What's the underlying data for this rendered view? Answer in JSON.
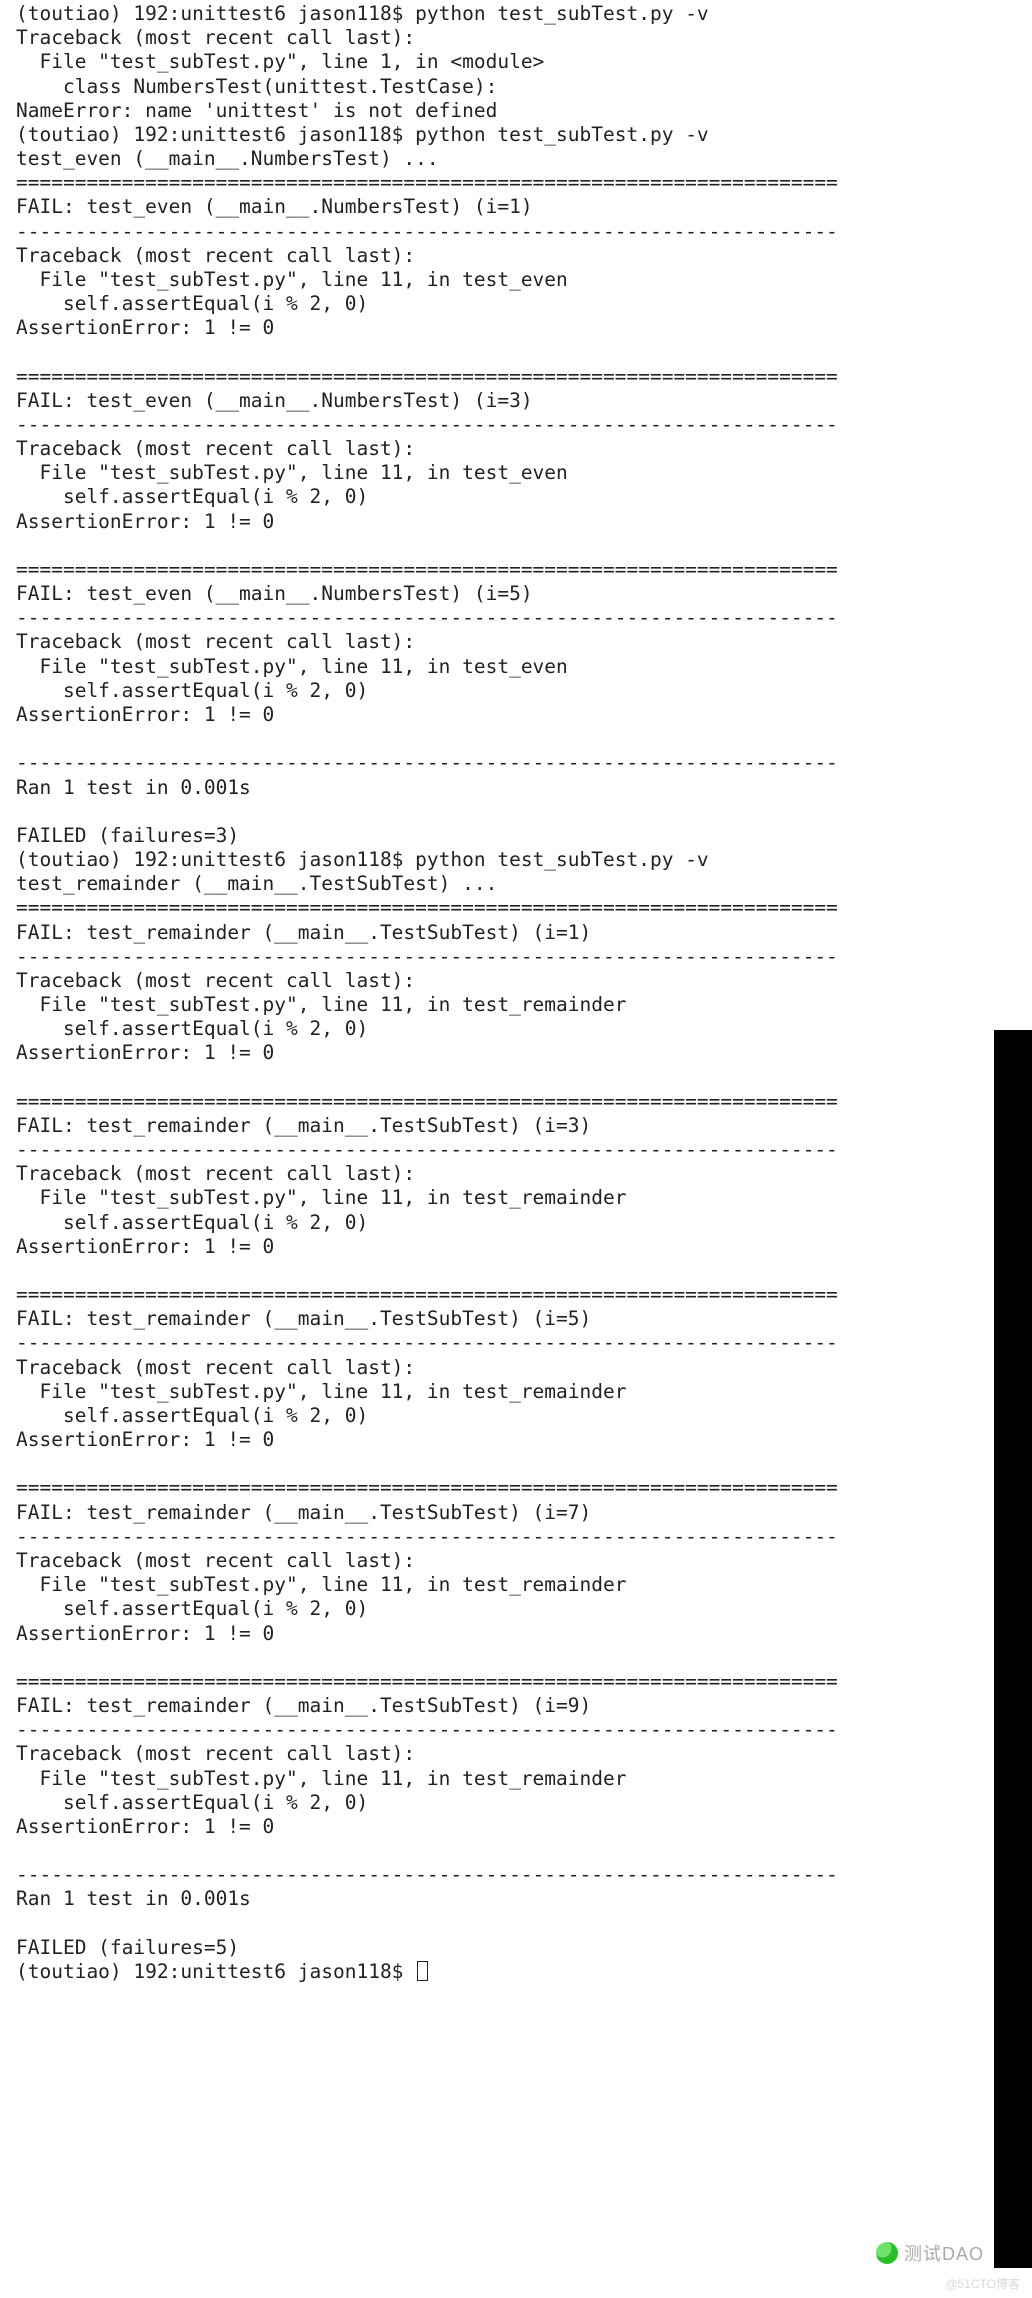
{
  "sep_eq": "======================================================================",
  "sep_dash": "----------------------------------------------------------------------",
  "prompt": "(toutiao) 192:unittest6 jason118$",
  "cmd": "python test_subTest.py -v",
  "tb_header": "Traceback (most recent call last):",
  "assert_line": "    self.assertEqual(i % 2, 0)",
  "assert_err": "AssertionError: 1 != 0",
  "run1": {
    "file_mod": "  File \"test_subTest.py\", line 1, in <module>",
    "cls_line": "    class NumbersTest(unittest.TestCase):",
    "name_err": "NameError: name 'unittest' is not defined"
  },
  "run2": {
    "start": "test_even (__main__.NumbersTest) ...",
    "file_line": "  File \"test_subTest.py\", line 11, in test_even",
    "fail1": "FAIL: test_even (__main__.NumbersTest) (i=1)",
    "fail3": "FAIL: test_even (__main__.NumbersTest) (i=3)",
    "fail5": "FAIL: test_even (__main__.NumbersTest) (i=5)",
    "ran": "Ran 1 test in 0.001s",
    "failed": "FAILED (failures=3)"
  },
  "run3": {
    "start": "test_remainder (__main__.TestSubTest) ...",
    "file_line": "  File \"test_subTest.py\", line 11, in test_remainder",
    "fail1": "FAIL: test_remainder (__main__.TestSubTest) (i=1)",
    "fail3": "FAIL: test_remainder (__main__.TestSubTest) (i=3)",
    "fail5": "FAIL: test_remainder (__main__.TestSubTest) (i=5)",
    "fail7": "FAIL: test_remainder (__main__.TestSubTest) (i=7)",
    "fail9": "FAIL: test_remainder (__main__.TestSubTest) (i=9)",
    "ran": "Ran 1 test in 0.001s",
    "failed": "FAILED (failures=5)"
  },
  "watermark": "测试DAO",
  "watermark2": "@51CTO博客"
}
